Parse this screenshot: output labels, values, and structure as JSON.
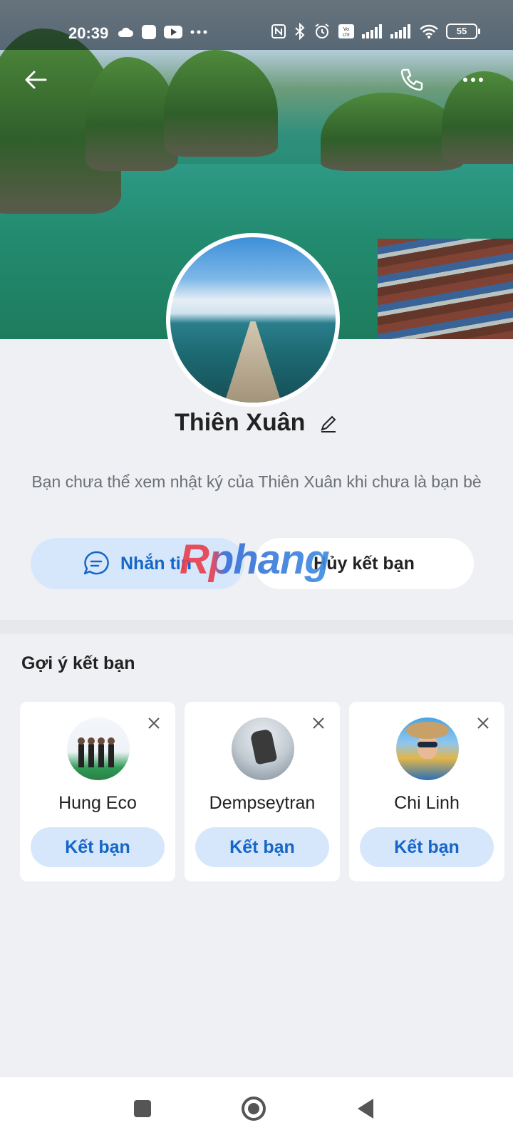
{
  "status_bar": {
    "time": "20:39",
    "left_icons": [
      "cloud-icon",
      "app-square-icon",
      "youtube-icon",
      "more-dots-icon"
    ],
    "right_icons": [
      "nfc-icon",
      "bluetooth-icon",
      "alarm-icon",
      "volte-icon",
      "signal-icon",
      "signal-icon",
      "wifi-icon"
    ],
    "battery": "55"
  },
  "header": {
    "back_icon": "arrow-left-icon",
    "call_icon": "phone-icon",
    "more_icon": "more-dots-icon"
  },
  "profile": {
    "name": "Thiên Xuân",
    "edit_icon": "pencil-icon",
    "notice": "Bạn chưa thể xem nhật ký của Thiên Xuân khi chưa là bạn bè"
  },
  "actions": {
    "message_label": "Nhắn tin",
    "unfriend_label": "Hủy kết bạn"
  },
  "watermark": "Rphang",
  "suggestions": {
    "title": "Gợi ý kết bạn",
    "items": [
      {
        "name": "Hung Eco",
        "add_label": "Kết bạn"
      },
      {
        "name": "Dempseytran",
        "add_label": "Kết bạn"
      },
      {
        "name": "Chi Linh",
        "add_label": "Kết bạn"
      }
    ]
  },
  "nav_bar": {
    "buttons": [
      "recent-apps-icon",
      "home-icon",
      "back-triangle-icon"
    ]
  },
  "colors": {
    "accent": "#1566c8",
    "accent_bg": "#d7e7fb",
    "page_bg": "#eef0f3"
  }
}
